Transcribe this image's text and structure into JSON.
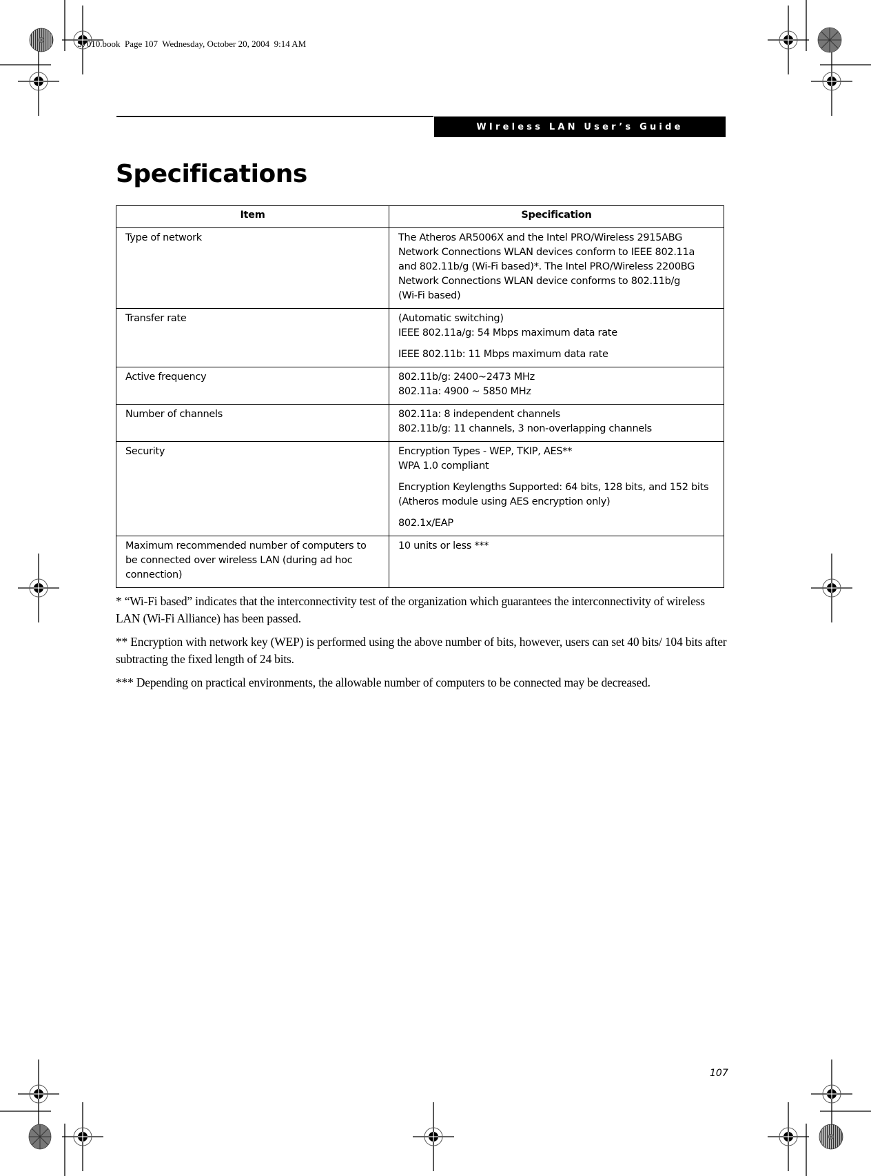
{
  "slug": "S7010.book  Page 107  Wednesday, October 20, 2004  9:14 AM",
  "header": {
    "running_title": "WIreless LAN User’s Guide"
  },
  "page_title": "Specifications",
  "table": {
    "columns": [
      "Item",
      "Specification"
    ],
    "rows": [
      {
        "item": "Type of network",
        "spec": [
          [
            "The Atheros AR5006X and the Intel PRO/Wireless 2915ABG",
            "Network Connections WLAN devices conform to IEEE 802.11a",
            "and 802.11b/g (Wi-Fi based)*. The Intel PRO/Wireless 2200BG",
            "Network Connections WLAN device conforms to 802.11b/g",
            "(Wi-Fi based)"
          ]
        ]
      },
      {
        "item": "Transfer rate",
        "spec": [
          [
            "(Automatic switching)",
            "IEEE 802.11a/g: 54 Mbps maximum data rate"
          ],
          [
            "IEEE 802.11b: 11 Mbps maximum data rate"
          ]
        ]
      },
      {
        "item": "Active frequency",
        "spec": [
          [
            "802.11b/g: 2400~2473 MHz",
            "802.11a: 4900 ~ 5850 MHz"
          ]
        ]
      },
      {
        "item": "Number of channels",
        "spec": [
          [
            "802.11a: 8 independent channels",
            "802.11b/g: 11 channels, 3 non-overlapping channels"
          ]
        ]
      },
      {
        "item": "Security",
        "spec": [
          [
            "Encryption Types - WEP, TKIP, AES**",
            "WPA 1.0 compliant"
          ],
          [
            "Encryption Keylengths Supported: 64 bits, 128 bits, and 152 bits",
            "(Atheros module using AES encryption only)"
          ],
          [
            "802.1x/EAP"
          ]
        ]
      },
      {
        "item": "Maximum recommended number of computers to be connected over wireless LAN (during ad hoc connection)",
        "spec": [
          [
            "10 units or less ***"
          ]
        ]
      }
    ]
  },
  "footnotes": [
    "* “Wi-Fi based” indicates that the interconnectivity test of the organization which guarantees the interconnectivity of wireless LAN (Wi-Fi Alliance) has been passed.",
    "** Encryption with network key (WEP) is performed using the above number of bits, however, users can set 40 bits/ 104 bits after subtracting the fixed length of 24 bits.",
    "*** Depending on practical environments, the allowable number of computers to be connected may be decreased."
  ],
  "page_number": "107"
}
